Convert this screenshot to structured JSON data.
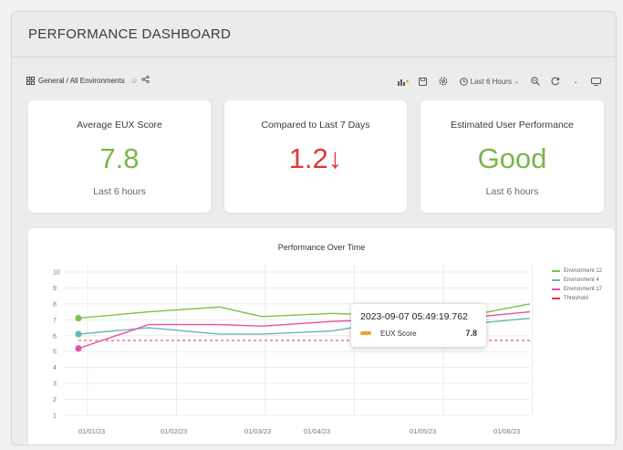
{
  "header": {
    "title": "PERFORMANCE DASHBOARD"
  },
  "toolbar": {
    "breadcrumb": "General / All Environments",
    "star_icon": "star-icon",
    "share_icon": "share-icon",
    "time_range": "Last 6 Hours",
    "icons": [
      "add-panel-icon",
      "save-icon",
      "settings-icon",
      "clock-icon",
      "zoom-out-icon",
      "refresh-icon",
      "chevron-down-icon",
      "tv-mode-icon"
    ]
  },
  "kpis": [
    {
      "label": "Average EUX Score",
      "value": "7.8",
      "sub": "Last 6 hours",
      "color": "#7ab648"
    },
    {
      "label": "Compared to Last 7 Days",
      "value": "1.2↓",
      "sub": "",
      "color": "#e0353a"
    },
    {
      "label": "Estimated User Performance",
      "value": "Good",
      "sub": "Last 6 hours",
      "color": "#7ab648"
    }
  ],
  "chart_data": {
    "type": "line",
    "title": "Performance Over Time",
    "xlabel": "",
    "ylabel": "",
    "x": [
      "01/01/23",
      "01/02/23",
      "01/03/23",
      "01/04/23",
      "01/05/23",
      "01/06/23"
    ],
    "x_ticks": [
      "01/01/23",
      "01/02/23",
      "01/03/23",
      "01/04/23",
      "01/05/23",
      "01/06/23"
    ],
    "y_ticks": [
      1,
      2,
      3,
      4,
      5,
      6,
      7,
      8,
      9,
      10
    ],
    "ylim": [
      1,
      10
    ],
    "series": [
      {
        "name": "Environment 12",
        "color": "#7dc24b",
        "values": [
          7.1,
          7.5,
          7.8,
          7.2,
          7.4,
          7.3,
          7.2,
          7.4,
          8.0
        ]
      },
      {
        "name": "Environment 4",
        "color": "#66b8b4",
        "values": [
          6.1,
          6.5,
          6.1,
          6.1,
          6.3,
          6.8,
          6.6,
          6.8,
          7.1
        ]
      },
      {
        "name": "Environment 17",
        "color": "#e452a6",
        "values": [
          5.2,
          6.7,
          6.7,
          6.6,
          6.9,
          7.0,
          7.1,
          7.2,
          7.5
        ]
      }
    ],
    "series_x": [
      0,
      1,
      2,
      2.6,
      3.6,
      4.3,
      5.0,
      5.7,
      6.4
    ],
    "threshold": {
      "name": "Threshold",
      "value": 5.7,
      "color": "#e53935"
    },
    "grid": true,
    "legend": "top-right",
    "tooltip": {
      "time": "2023-09-07 05:49:19.762",
      "label": "EUX Score",
      "value": "7.8",
      "color": "#f0a030"
    }
  }
}
